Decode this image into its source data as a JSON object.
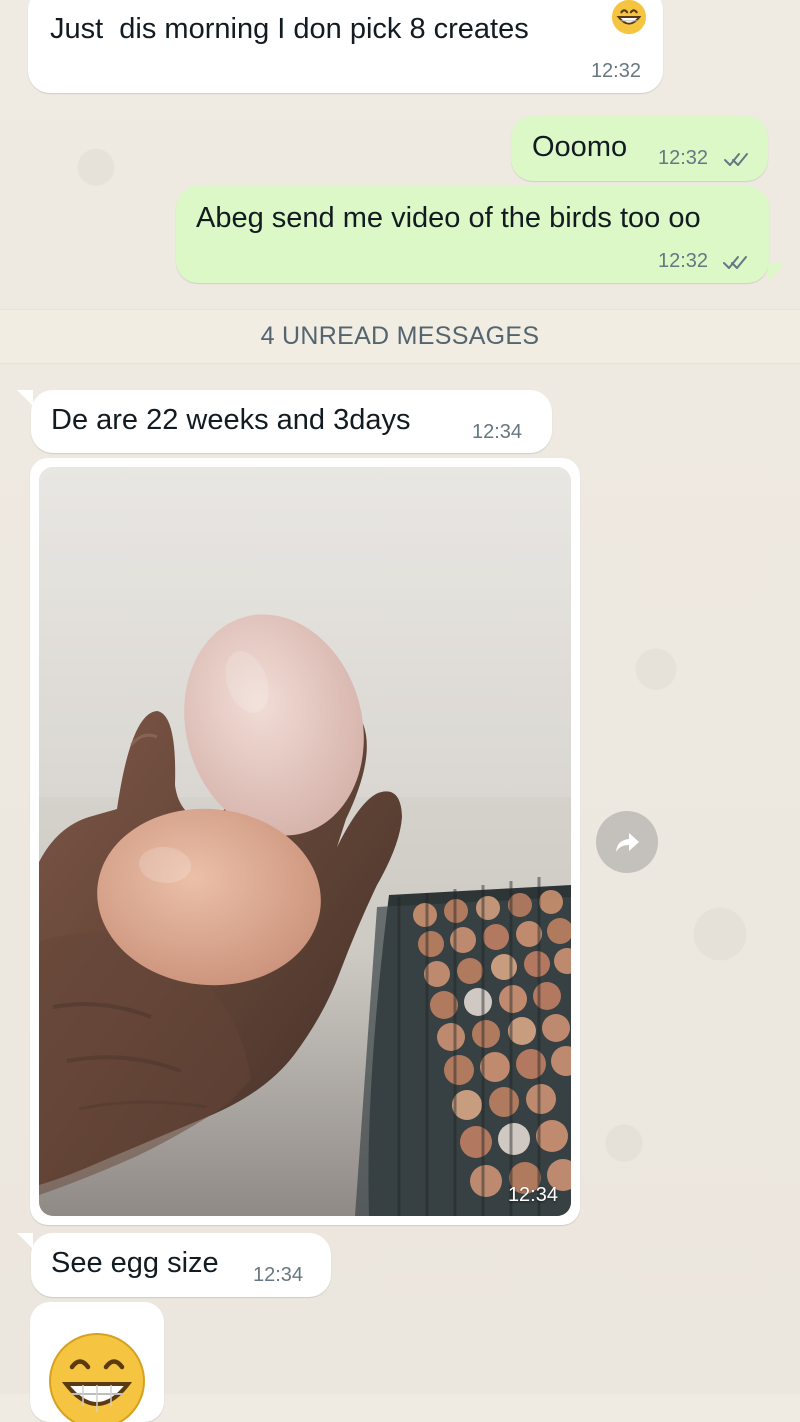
{
  "messages": [
    {
      "id": "msg-1",
      "direction": "incoming",
      "text": "Just  dis morning I don pick 8 creates",
      "emoji_name": "grinning-face",
      "time": "12:32"
    },
    {
      "id": "msg-2",
      "direction": "outgoing",
      "text": "Ooomo",
      "time": "12:32",
      "status_icon": "double-check-icon"
    },
    {
      "id": "msg-3",
      "direction": "outgoing",
      "text": "Abeg send me video of the birds too oo",
      "time": "12:32",
      "status_icon": "double-check-icon"
    },
    {
      "id": "msg-4",
      "direction": "incoming",
      "text": "De are 22 weeks and 3days",
      "time": "12:34"
    },
    {
      "id": "msg-5",
      "direction": "incoming",
      "type": "image",
      "image_subject": "eggs-in-hand-photo",
      "time": "12:34"
    },
    {
      "id": "msg-6",
      "direction": "incoming",
      "text": "See egg size",
      "time": "12:34"
    },
    {
      "id": "msg-7",
      "direction": "incoming",
      "type": "emoji",
      "emoji_name": "grinning-face"
    }
  ],
  "unread_divider": {
    "label": "4 UNREAD MESSAGES"
  },
  "icons": {
    "forward": "share-forward-icon",
    "read_receipt": "double-check-icon",
    "emoji": "grinning-face-icon"
  },
  "colors": {
    "chat_background": "#efeae2",
    "incoming_bubble": "#ffffff",
    "outgoing_bubble": "#dcf8c6",
    "timestamp": "#667781",
    "unread_banner": "#f1ede3",
    "read_check": "#667781"
  }
}
